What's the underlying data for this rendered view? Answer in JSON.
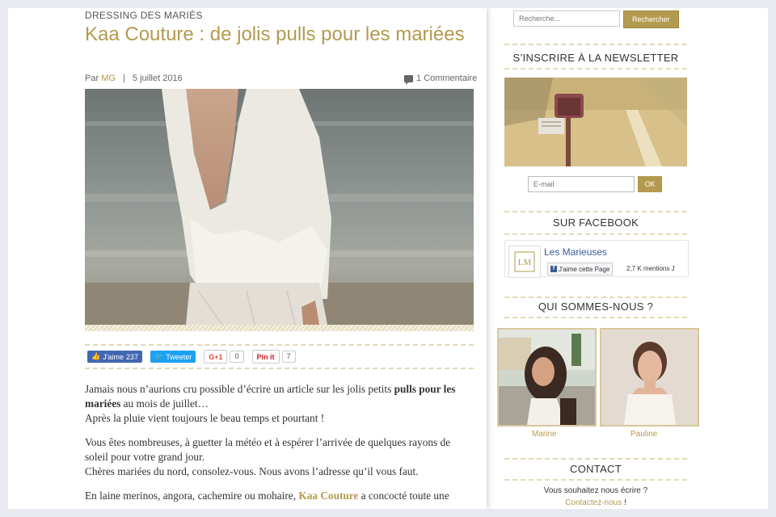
{
  "post": {
    "category": "DRESSING DES MARIÉS",
    "title": "Kaa Couture : de jolis pulls pour les mariées",
    "by": "Par",
    "author": "MG",
    "date": "5 juillet 2016",
    "comments": "1 Commentaire",
    "social": {
      "fb_label": "J'aime",
      "fb_count": "237",
      "tw_label": "Tweeter",
      "gp_label": "G+1",
      "gp_count": "0",
      "pin_label": "Pin it",
      "pin_count": "7"
    },
    "body": {
      "p1_a": "Jamais nous n’aurions cru possible d’écrire un article sur les jolis petits ",
      "p1_b": "pulls pour les mariées",
      "p1_c": " au mois de juillet…",
      "p1_d": "Après la pluie vient toujours le beau temps et pourtant !",
      "p2_a": "Vous êtes nombreuses, à guetter la météo et à espérer l’arrivée de quelques rayons de soleil pour votre grand jour.",
      "p2_b": "Chères mariées du nord, consolez-vous. Nous avons l’adresse qu’il vous faut.",
      "p3_a": "En laine merinos, angora, cachemire ou mohaire, ",
      "p3_b": "Kaa Couture",
      "p3_c": " a concocté toute une"
    }
  },
  "sidebar": {
    "search_placeholder": "Recherche...",
    "search_button": "Rechercher",
    "newsletter_title": "S’INSCRIRE À LA NEWSLETTER",
    "email_placeholder": "E-mail",
    "ok_button": "OK",
    "facebook_title": "SUR FACEBOOK",
    "fb_page_name": "Les Marieuses",
    "fb_like": "J'aime cette Page",
    "fb_count": "2,7 K mentions J",
    "about_title": "QUI SOMMES-NOUS ?",
    "members": [
      "Marine",
      "Pauline"
    ],
    "contact_title": "CONTACT",
    "contact_text": "Vous souhaitez nous écrire ?",
    "contact_link": "Contactez-nous"
  }
}
